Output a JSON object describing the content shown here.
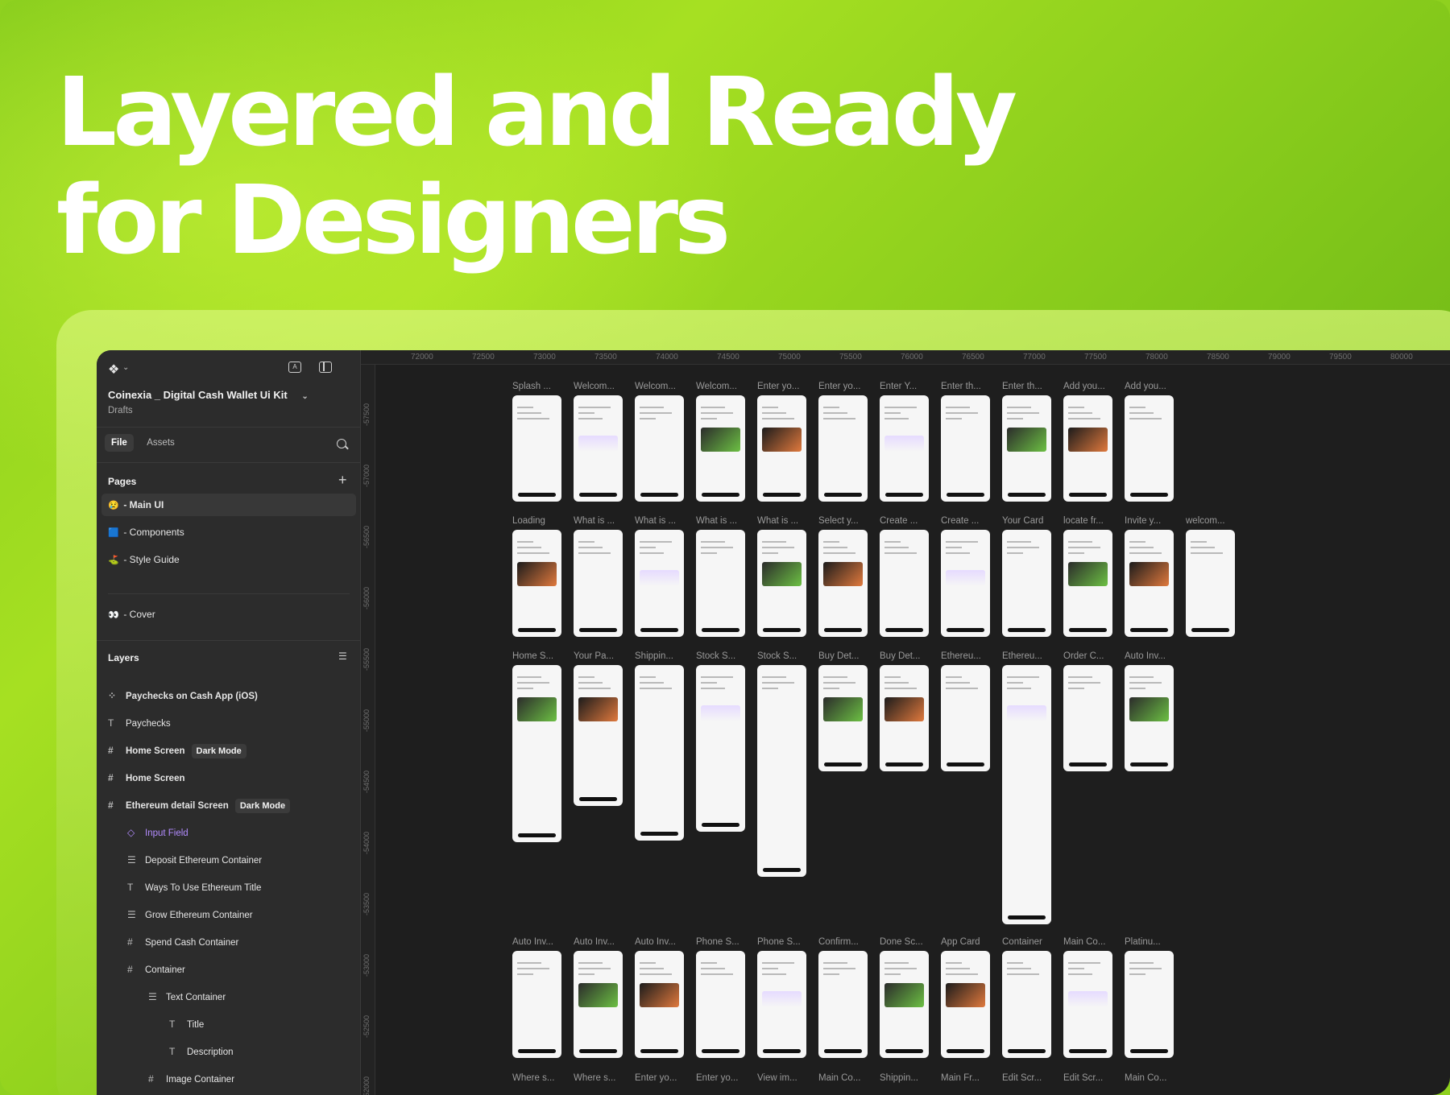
{
  "headline": {
    "line1": "Layered and Ready",
    "line2": "for Designers"
  },
  "sidebar": {
    "file_name": "Coinexia _ Digital Cash Wallet Ui Kit",
    "file_location": "Drafts",
    "tabs": {
      "file": "File",
      "assets": "Assets"
    },
    "pages_title": "Pages",
    "pages": [
      {
        "emoji": "😢",
        "label": "- Main UI",
        "selected": true
      },
      {
        "emoji": "🟦",
        "label": "- Components"
      },
      {
        "emoji": "⛳",
        "label": "- Style Guide"
      },
      {
        "emoji": "👀",
        "label": "- Cover"
      }
    ],
    "layers_title": "Layers",
    "layers": [
      {
        "icon": "component-set-icon",
        "label": "Paychecks on Cash App (iOS)",
        "badge": ""
      },
      {
        "icon": "text-icon",
        "label": "Paychecks",
        "badge": ""
      },
      {
        "icon": "frame-icon",
        "label": "Home Screen",
        "badge": "Dark Mode"
      },
      {
        "icon": "frame-icon",
        "label": "Home Screen",
        "badge": ""
      },
      {
        "icon": "frame-icon",
        "label": "Ethereum detail Screen",
        "badge": "Dark Mode"
      },
      {
        "icon": "instance-icon",
        "label": "Input Field",
        "badge": ""
      },
      {
        "icon": "autolayout-icon",
        "label": "Deposit Ethereum Container",
        "badge": ""
      },
      {
        "icon": "text-icon",
        "label": "Ways To Use Ethereum Title",
        "badge": ""
      },
      {
        "icon": "autolayout-icon",
        "label": "Grow Ethereum Container",
        "badge": ""
      },
      {
        "icon": "frame-icon",
        "label": "Spend Cash Container",
        "badge": ""
      },
      {
        "icon": "frame-icon",
        "label": "Container",
        "badge": ""
      },
      {
        "icon": "autolayout-icon",
        "label": "Text Container",
        "badge": ""
      },
      {
        "icon": "text-icon",
        "label": "Title",
        "badge": ""
      },
      {
        "icon": "text-icon",
        "label": "Description",
        "badge": ""
      },
      {
        "icon": "frame-icon",
        "label": "Image Container",
        "badge": ""
      }
    ]
  },
  "rulers": {
    "top": [
      "72000",
      "72500",
      "73000",
      "73500",
      "74000",
      "74500",
      "75000",
      "75500",
      "76000",
      "76500",
      "77000",
      "77500",
      "78000",
      "78500",
      "79000",
      "79500",
      "80000"
    ],
    "left": [
      "-57500",
      "-57000",
      "-56500",
      "-56000",
      "-55500",
      "-55000",
      "-54500",
      "-54000",
      "-53500",
      "-53000",
      "-52500",
      "-52000"
    ]
  },
  "frames": {
    "row1": [
      "Splash ...",
      "Welcom...",
      "Welcom...",
      "Welcom...",
      "Enter yo...",
      "Enter yo...",
      "Enter Y...",
      "Enter th...",
      "Enter th...",
      "Add you...",
      "Add you..."
    ],
    "row2": [
      "Loading",
      "What is ...",
      "What is ...",
      "What is ...",
      "What is ...",
      "Select y...",
      "Create ...",
      "Create ...",
      "Your Card",
      "locate fr...",
      "Invite y...",
      "welcom..."
    ],
    "row3": [
      "Home S...",
      "Your Pa...",
      "Shippin...",
      "Stock S...",
      "Stock S...",
      "Buy Det...",
      "Buy Det...",
      "Ethereu...",
      "Ethereu...",
      "Order C...",
      "Auto Inv..."
    ],
    "row4": [
      "Auto Inv...",
      "Auto Inv...",
      "Auto Inv...",
      "Phone S...",
      "Phone S...",
      "Confirm...",
      "Done Sc...",
      "App Card",
      "Container",
      "Main Co...",
      "Platinu..."
    ],
    "row5": [
      "Where s...",
      "Where s...",
      "Enter yo...",
      "Enter yo...",
      "View im...",
      "Main Co...",
      "Shippin...",
      "Main Fr...",
      "Edit Scr...",
      "Edit Scr...",
      "Main Co..."
    ]
  },
  "colors": {
    "accent_green": "#a6e022",
    "canvas_bg": "#1e1e1e",
    "sidebar_bg": "#2c2c2c",
    "layer_instance": "#b38cff"
  }
}
